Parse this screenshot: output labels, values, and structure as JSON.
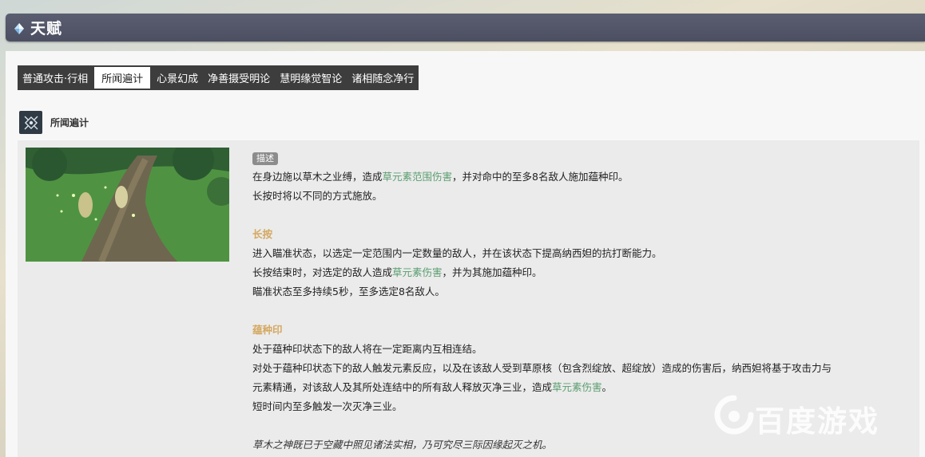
{
  "header": {
    "title": "天赋",
    "icon": "diamond-gem-icon"
  },
  "tabs": [
    {
      "label": "普通攻击·行相",
      "active": false
    },
    {
      "label": "所闻遍计",
      "active": true
    },
    {
      "label": "心景幻成",
      "active": false
    },
    {
      "label": "净善摄受明论",
      "active": false
    },
    {
      "label": "慧明缘觉智论",
      "active": false
    },
    {
      "label": "诸相随念净行",
      "active": false
    }
  ],
  "skill": {
    "name": "所闻遍计",
    "icon": "seed-of-skandha-icon"
  },
  "description": {
    "tag": "描述",
    "intro_a": "在身边施以草木之业缚，造成",
    "intro_dmg": "草元素范围伤害",
    "intro_b": "，并对命中的至多8名敌人施加蕴种印。",
    "intro_line2": "长按时将以不同的方式施放。",
    "hold_title": "长按",
    "hold_line1": "进入瞄准状态，以选定一定范围内一定数量的敌人，并在该状态下提高纳西妲的抗打断能力。",
    "hold_line2_a": "长按结束时，对选定的敌人造成",
    "hold_line2_dmg": "草元素伤害",
    "hold_line2_b": "，并为其施加蕴种印。",
    "hold_line3": "瞄准状态至多持续5秒，至多选定8名敌人。",
    "seed_title": "蕴种印",
    "seed_line1": "处于蕴种印状态下的敌人将在一定距离内互相连结。",
    "seed_line2": "对处于蕴种印状态下的敌人触发元素反应，以及在该敌人受到草原核（包含烈绽放、超绽放）造成的伤害后，纳西妲将基于攻击力与",
    "seed_line3_a": "元素精通，对该敌人及其所处连结中的所有敌人释放灭净三业，造成",
    "seed_line3_dmg": "草元素伤害",
    "seed_line3_b": "。",
    "seed_line4": "短时间内至多触发一次灭净三业。",
    "quote": "草木之神既已于空藏中照见诸法实相，乃可究尽三际因缘起灭之机。"
  },
  "watermark": {
    "text": "百度游戏",
    "icon": "baidu-paw-icon"
  },
  "colors": {
    "header_bg": "#4f5366",
    "tab_bar": "#3d3d3d",
    "dendro": "#5a9e6f",
    "subtitle": "#d4a861"
  }
}
